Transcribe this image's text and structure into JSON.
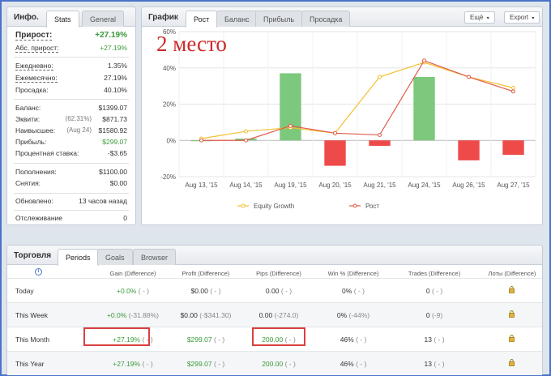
{
  "info": {
    "title": "Инфо.",
    "tabs": [
      "Stats",
      "General"
    ],
    "rows": [
      {
        "label": "Прирост:",
        "value": "+27.19%",
        "sub": ""
      },
      {
        "label": "Абс. прирост:",
        "value": "+27.19%",
        "sub": ""
      },
      {
        "label": "Ежедневно:",
        "value": "1.35%",
        "sub": ""
      },
      {
        "label": "Ежемесячно:",
        "value": "27.19%",
        "sub": ""
      },
      {
        "label": "Просадка:",
        "value": "40.10%",
        "sub": ""
      },
      {
        "label": "Баланс:",
        "value": "$1399.07",
        "sub": ""
      },
      {
        "label": "Эквити:",
        "value": "$871.73",
        "sub": "(62.31%)"
      },
      {
        "label": "Наивысшее:",
        "value": "$1580.92",
        "sub": "(Aug 24)"
      },
      {
        "label": "Прибыль:",
        "value": "$299.07",
        "sub": ""
      },
      {
        "label": "Процентная ставка:",
        "value": "-$3.65",
        "sub": ""
      },
      {
        "label": "Пополнения:",
        "value": "$1100.00",
        "sub": ""
      },
      {
        "label": "Снятия:",
        "value": "$0.00",
        "sub": ""
      },
      {
        "label": "Обновлено:",
        "value": "13 часов назад",
        "sub": ""
      },
      {
        "label": "Отслеживание",
        "value": "0",
        "sub": ""
      }
    ]
  },
  "graph": {
    "title": "График",
    "tabs": [
      "Рост",
      "Баланс",
      "Прибыль",
      "Просадка"
    ],
    "buttons": [
      "Ещё",
      "Export"
    ],
    "overlay_text": "2 место"
  },
  "chart_data": {
    "type": "bar",
    "categories": [
      "Aug 13, '15",
      "Aug 14, '15",
      "Aug 19, '15",
      "Aug 20, '15",
      "Aug 21, '15",
      "Aug 24, '15",
      "Aug 26, '15",
      "Aug 27, '15"
    ],
    "bars": [
      0,
      1,
      37,
      -14,
      -3,
      35,
      -11,
      -8
    ],
    "series": [
      {
        "name": "Equity Growth",
        "values": [
          1,
          5,
          7,
          4,
          35,
          43,
          35,
          29
        ]
      },
      {
        "name": "Рост",
        "values": [
          0,
          0,
          8,
          4,
          3,
          44,
          35,
          27
        ]
      }
    ],
    "yticks": [
      "60%",
      "40%",
      "20%",
      "0%",
      "-20%"
    ],
    "ylim": [
      -20,
      60
    ],
    "colors": {
      "bar_pos": "#7cc87c",
      "bar_neg": "#ef4a4a",
      "equity": "#f2c12e",
      "growth": "#e05a4a"
    },
    "legend": "bottom"
  },
  "trading": {
    "title": "Торговля",
    "tabs": [
      "Periods",
      "Goals",
      "Browser"
    ],
    "columns": [
      "Gain (Difference)",
      "Profit (Difference)",
      "Pips (Difference)",
      "Win % (Difference)",
      "Trades (Difference)",
      "Лоты (Difference)"
    ],
    "rows": [
      {
        "label": "Today",
        "gain": "+0.0%",
        "gain_d": "( - )",
        "profit": "$0.00",
        "profit_d": "( - )",
        "pips": "0.00",
        "pips_d": "( - )",
        "win": "0%",
        "win_d": "( - )",
        "trades": "0",
        "trades_d": "( - )"
      },
      {
        "label": "This Week",
        "gain": "+0.0%",
        "gain_d": "(-31.88%)",
        "profit": "$0.00",
        "profit_d": "(-$341.30)",
        "pips": "0.00",
        "pips_d": "(-274.0)",
        "win": "0%",
        "win_d": "(-44%)",
        "trades": "0",
        "trades_d": "(-9)"
      },
      {
        "label": "This Month",
        "gain": "+27.19%",
        "gain_d": "( - )",
        "profit": "$299.07",
        "profit_d": "( - )",
        "pips": "200.00",
        "pips_d": "( - )",
        "win": "46%",
        "win_d": "( - )",
        "trades": "13",
        "trades_d": "( - )"
      },
      {
        "label": "This Year",
        "gain": "+27.19%",
        "gain_d": "( - )",
        "profit": "$299.07",
        "profit_d": "( - )",
        "pips": "200.00",
        "pips_d": "( - )",
        "win": "46%",
        "win_d": "( - )",
        "trades": "13",
        "trades_d": "( - )"
      }
    ]
  }
}
